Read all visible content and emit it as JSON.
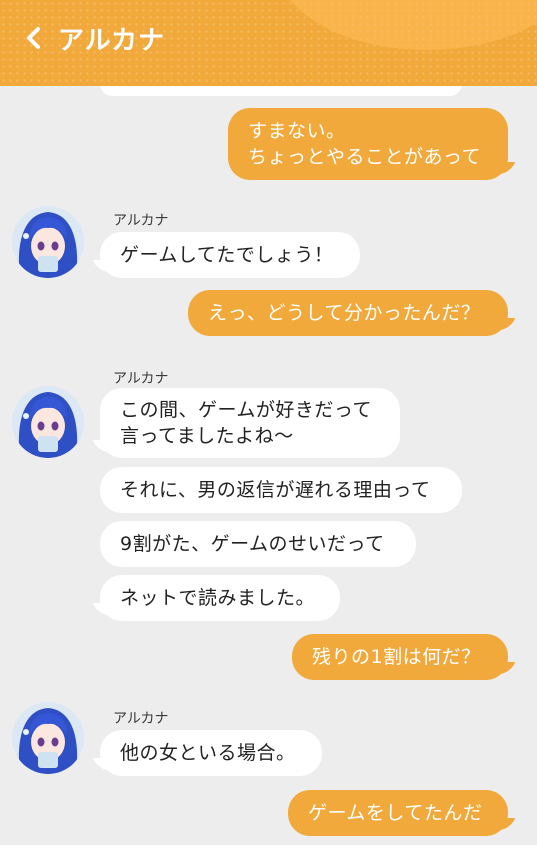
{
  "header": {
    "title": "アルカナ",
    "back_icon": "chevron-left-icon"
  },
  "colors": {
    "accent": "#f2a93b",
    "background": "#ededed",
    "incoming": "#ffffff"
  },
  "messages": {
    "m1": {
      "lines": [
        "すまない。",
        "ちょっとやることがあって"
      ]
    },
    "g1": {
      "sender": "アルカナ",
      "b1": "ゲームしてたでしょう！"
    },
    "m2": {
      "text": "えっ、どうして分かったんだ？"
    },
    "g2": {
      "sender": "アルカナ",
      "b1": [
        "この間、ゲームが好きだって",
        "言ってましたよね～"
      ],
      "b2": "それに、男の返信が遅れる理由って",
      "b3": "9割がた、ゲームのせいだって",
      "b4": "ネットで読みました。"
    },
    "m3": {
      "text": "残りの1割は何だ？"
    },
    "g3": {
      "sender": "アルカナ",
      "b1": "他の女といる場合。"
    },
    "m4": {
      "text": "ゲームをしてたんだ"
    }
  }
}
